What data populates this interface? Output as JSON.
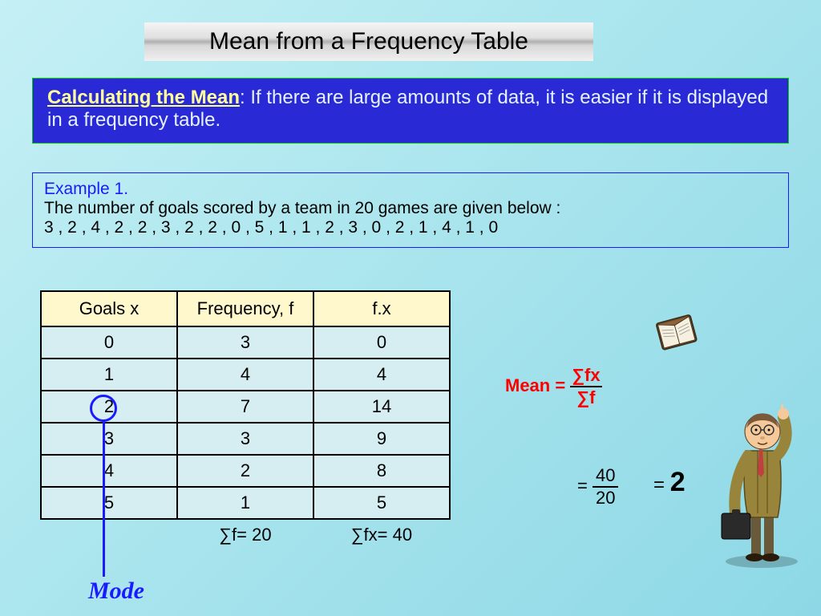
{
  "title": "Mean from a Frequency Table",
  "intro": {
    "lead": "Calculating the Mean",
    "text": ": If there are large amounts of data, it is easier if it is displayed in a frequency table."
  },
  "example": {
    "label": "Example 1.",
    "line1": "The number of goals scored by a team in 20 games are given below :",
    "data": "3 , 2 , 4 , 2 , 2 , 3 , 2 , 2 , 0 , 5 , 1 , 1 , 2 , 3 , 0 , 2 , 1 , 4 , 1 , 0"
  },
  "table": {
    "headers": {
      "col1": "Goals  x",
      "col2": "Frequency, f",
      "col3": "f.x"
    },
    "rows": [
      {
        "x": "0",
        "f": "3",
        "fx": "0"
      },
      {
        "x": "1",
        "f": "4",
        "fx": "4"
      },
      {
        "x": "2",
        "f": "7",
        "fx": "14"
      },
      {
        "x": "3",
        "f": "3",
        "fx": "9"
      },
      {
        "x": "4",
        "f": "2",
        "fx": "8"
      },
      {
        "x": "5",
        "f": "1",
        "fx": "5"
      }
    ],
    "totals": {
      "sumf": "∑f= 20",
      "sumfx": "∑fx= 40"
    }
  },
  "mode_label": "Mode",
  "mean": {
    "prefix": "Mean = ",
    "num": "∑fx",
    "den": "∑f",
    "eq1": "=",
    "val_num": "40",
    "val_den": "20",
    "eq2": "=",
    "result": "2"
  },
  "chart_data": {
    "type": "table",
    "title": "Frequency table of goals scored in 20 games",
    "columns": [
      "Goals x",
      "Frequency f",
      "f·x"
    ],
    "rows": [
      [
        0,
        3,
        0
      ],
      [
        1,
        4,
        4
      ],
      [
        2,
        7,
        14
      ],
      [
        3,
        3,
        9
      ],
      [
        4,
        2,
        8
      ],
      [
        5,
        1,
        5
      ]
    ],
    "sum_f": 20,
    "sum_fx": 40,
    "mean": 2,
    "mode": 2
  }
}
